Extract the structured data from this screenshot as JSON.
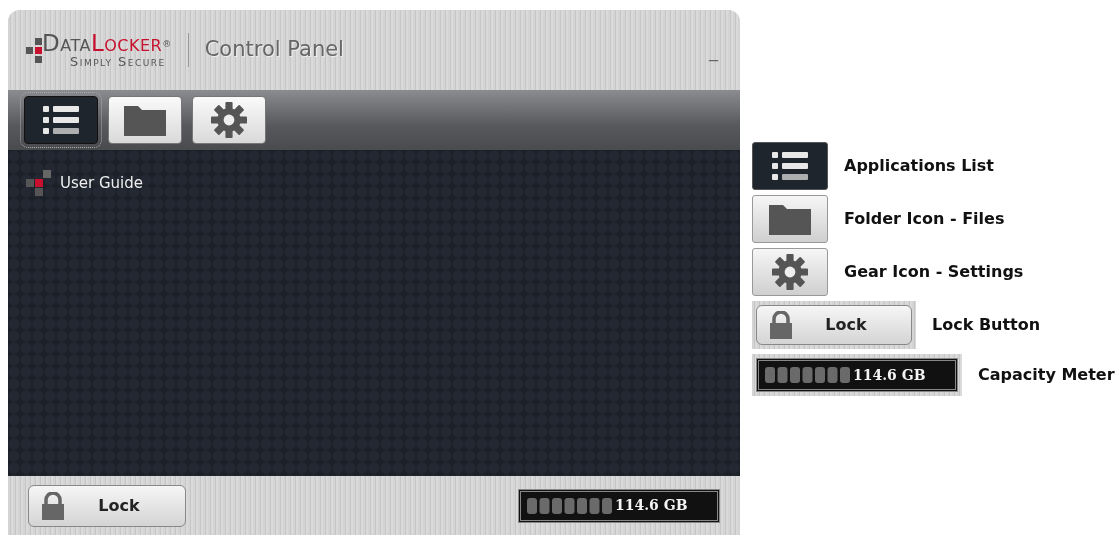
{
  "window": {
    "logo": {
      "part_1": "Data",
      "part_2": "Locker",
      "registered": "®",
      "tagline": "Simply Secure"
    },
    "title": "Control Panel",
    "minimize": "_"
  },
  "toolbar": [
    {
      "kind": "list",
      "selected": true
    },
    {
      "kind": "folder",
      "selected": false
    },
    {
      "kind": "gear",
      "selected": false
    }
  ],
  "applications": [
    {
      "label": "User Guide"
    }
  ],
  "footer": {
    "lock_button": "Lock",
    "capacity": "114.6 GB"
  },
  "legend": [
    {
      "kind": "list",
      "label": "Applications List"
    },
    {
      "kind": "folder",
      "label": "Folder Icon - Files"
    },
    {
      "kind": "gear",
      "label": "Gear Icon - Settings"
    },
    {
      "kind": "lock",
      "label": "Lock Button",
      "button_label": "Lock"
    },
    {
      "kind": "meter",
      "label": "Capacity Meter",
      "reading": "114.6 GB"
    }
  ]
}
